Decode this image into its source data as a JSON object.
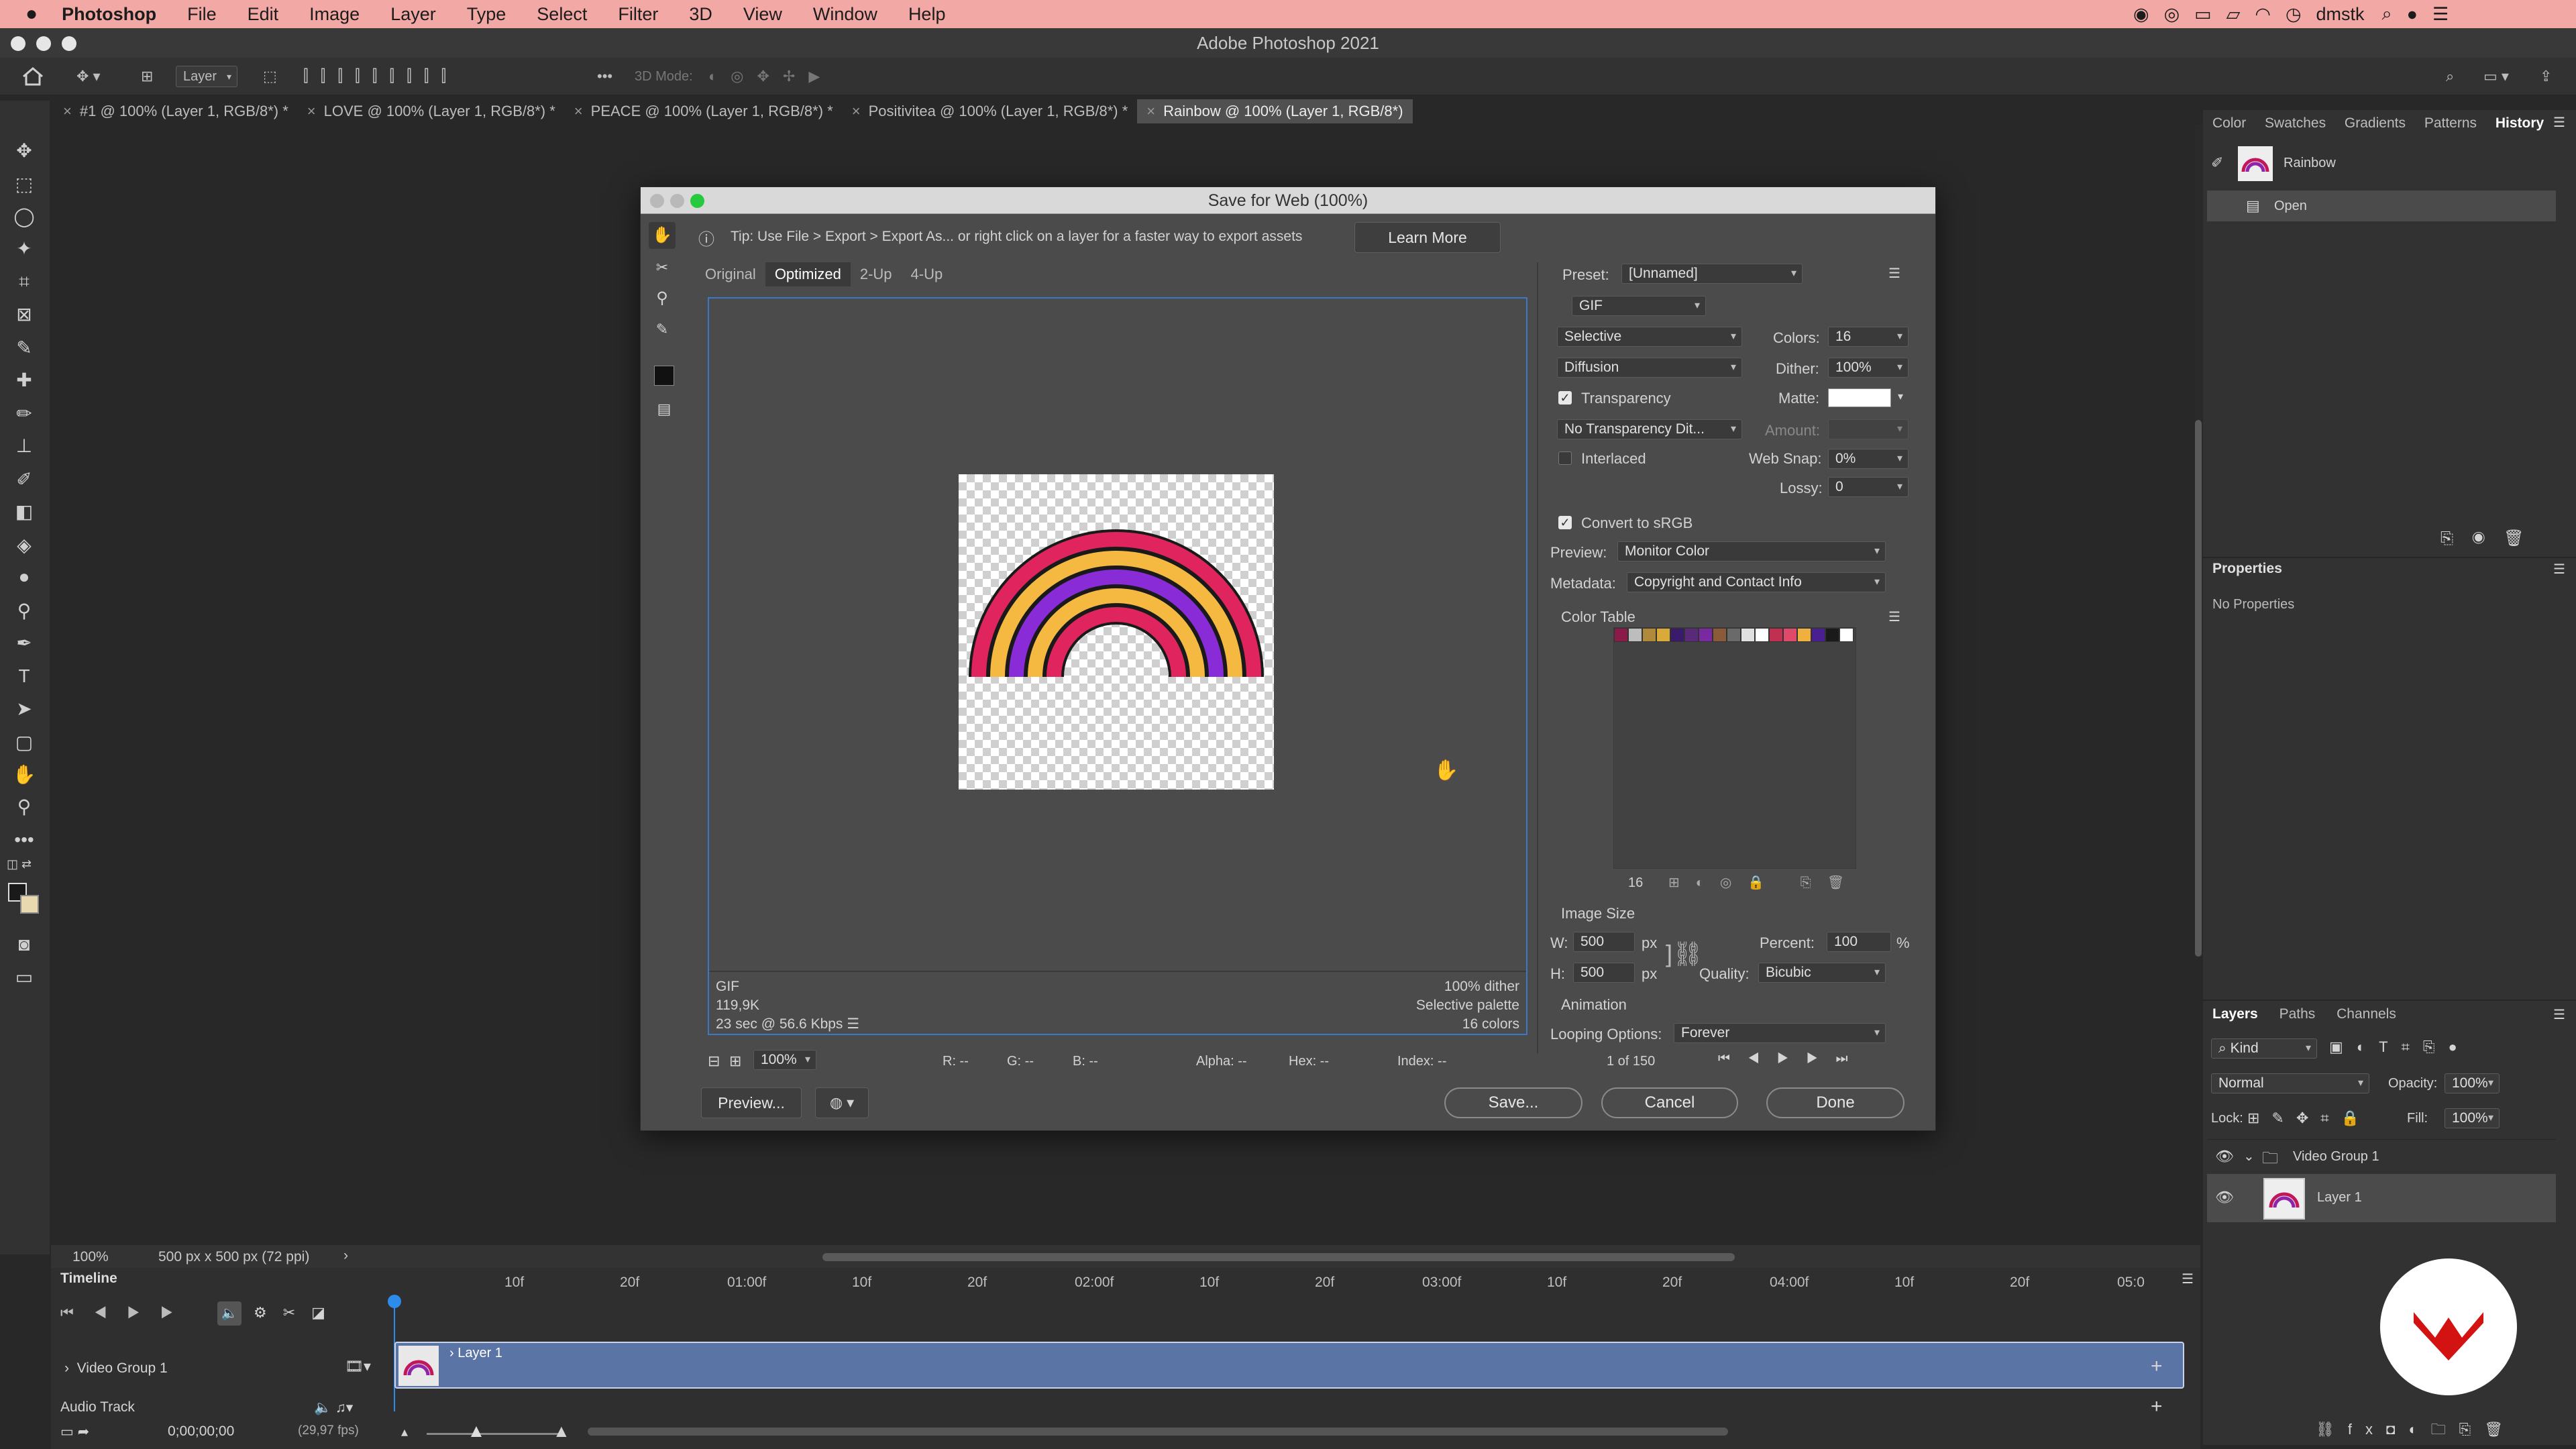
{
  "menubar": {
    "apple": "",
    "app": "Photoshop",
    "items": [
      "File",
      "Edit",
      "Image",
      "Layer",
      "Type",
      "Select",
      "Filter",
      "3D",
      "View",
      "Window",
      "Help"
    ],
    "user": "dmstk"
  },
  "window_title": "Adobe Photoshop 2021",
  "options": {
    "layer_select": "Layer",
    "mode_3d": "3D Mode:"
  },
  "tabs": [
    {
      "label": "#1 @ 100% (Layer 1, RGB/8*) *"
    },
    {
      "label": "LOVE @ 100% (Layer 1, RGB/8*) *"
    },
    {
      "label": "PEACE @ 100% (Layer 1, RGB/8*) *"
    },
    {
      "label": "Positivitea @ 100% (Layer 1, RGB/8*) *"
    },
    {
      "label": "Rainbow @ 100% (Layer 1, RGB/8*)"
    }
  ],
  "dialog": {
    "title": "Save for Web (100%)",
    "tip": "Tip: Use File > Export > Export As...  or right click on a layer for a faster way to export assets",
    "learn_more": "Learn More",
    "view_tabs": [
      "Original",
      "Optimized",
      "2-Up",
      "4-Up"
    ],
    "active_view": "Optimized",
    "preview_info_left": [
      "GIF",
      "119,9K",
      "23 sec @ 56.6 Kbps"
    ],
    "preview_info_right": [
      "100% dither",
      "Selective palette",
      "16 colors"
    ],
    "zoom": "100%",
    "readouts": {
      "r": "R: --",
      "g": "G: --",
      "b": "B: --",
      "alpha": "Alpha: --",
      "hex": "Hex: --",
      "index": "Index: --"
    },
    "preset_label": "Preset:",
    "preset_value": "[Unnamed]",
    "format": "GIF",
    "reduction": "Selective",
    "colors_label": "Colors:",
    "colors_value": "16",
    "dither_algo": "Diffusion",
    "dither_label": "Dither:",
    "dither_value": "100%",
    "transparency_label": "Transparency",
    "matte_label": "Matte:",
    "trans_dither": "No Transparency Dit...",
    "amount_label": "Amount:",
    "interlaced_label": "Interlaced",
    "websnap_label": "Web Snap:",
    "websnap_value": "0%",
    "lossy_label": "Lossy:",
    "lossy_value": "0",
    "srgb_label": "Convert to sRGB",
    "preview_label": "Preview:",
    "preview_value": "Monitor Color",
    "metadata_label": "Metadata:",
    "metadata_value": "Copyright and Contact Info",
    "color_table_label": "Color Table",
    "color_table": [
      "#8a1b48",
      "#bdbdbd",
      "#b08a3a",
      "#d9a93a",
      "#3a1a6a",
      "#5a2a7a",
      "#7a2aa0",
      "#8a5a3a",
      "#6a6a6a",
      "#e0e0e0",
      "#ffffff",
      "#c03050",
      "#e04a6a",
      "#f0b040",
      "#4a2090",
      "#1a1a1a",
      "#ffffff"
    ],
    "color_count": "16",
    "image_size_label": "Image Size",
    "w_label": "W:",
    "w_value": "500",
    "h_label": "H:",
    "h_value": "500",
    "px": "px",
    "percent_label": "Percent:",
    "percent_value": "100",
    "pct": "%",
    "quality_label": "Quality:",
    "quality_value": "Bicubic",
    "animation_label": "Animation",
    "looping_label": "Looping Options:",
    "looping_value": "Forever",
    "frame_counter": "1 of 150",
    "preview_btn": "Preview...",
    "save_btn": "Save...",
    "cancel_btn": "Cancel",
    "done_btn": "Done"
  },
  "right_panel": {
    "top_tabs": [
      "Color",
      "Swatches",
      "Gradients",
      "Patterns",
      "History"
    ],
    "history": [
      {
        "label": "Rainbow"
      },
      {
        "label": "Open"
      }
    ],
    "properties_title": "Properties",
    "properties_empty": "No Properties",
    "layer_tabs": [
      "Layers",
      "Paths",
      "Channels"
    ],
    "kind_filter": "Kind",
    "blend_mode": "Normal",
    "opacity_label": "Opacity:",
    "opacity_value": "100%",
    "lock_label": "Lock:",
    "fill_label": "Fill:",
    "fill_value": "100%",
    "layers": [
      {
        "name": "Video Group 1"
      },
      {
        "name": "Layer 1"
      }
    ]
  },
  "statusbar": {
    "zoom": "100%",
    "doc": "500 px x 500 px (72 ppi)"
  },
  "timeline": {
    "title": "Timeline",
    "ticks": [
      "10f",
      "20f",
      "01:00f",
      "10f",
      "20f",
      "02:00f",
      "10f",
      "20f",
      "03:00f",
      "10f",
      "20f",
      "04:00f",
      "10f",
      "20f",
      "05:0"
    ],
    "video_group": "Video Group 1",
    "clip_label": "Layer 1",
    "audio_track": "Audio Track",
    "timecode": "0;00;00;00",
    "fps": "(29,97 fps)"
  }
}
